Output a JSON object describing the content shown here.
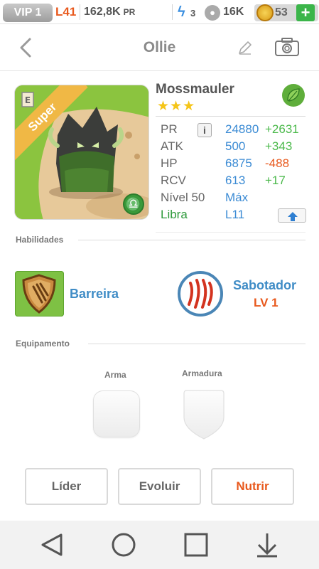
{
  "status": {
    "vip": "VIP 1",
    "level": "L41",
    "power": "162,8K",
    "power_unit": "PR",
    "energy": "3",
    "paws": "16K",
    "coins": "53",
    "add": "+"
  },
  "nav": {
    "title": "Ollie"
  },
  "monster": {
    "name": "Mossmauler",
    "rarity_ribbon": "Super",
    "stars": "★★★",
    "element": "leaf-icon",
    "stats": [
      {
        "label": "PR",
        "value": "24880",
        "bonus": "+2631",
        "bonus_type": "positive"
      },
      {
        "label": "ATK",
        "value": "500",
        "bonus": "+343",
        "bonus_type": "positive"
      },
      {
        "label": "HP",
        "value": "6875",
        "bonus": "-488",
        "bonus_type": "negative"
      },
      {
        "label": "RCV",
        "value": "613",
        "bonus": "+17",
        "bonus_type": "positive"
      }
    ],
    "level_label": "Nível 50",
    "level_value": "Máx",
    "sign_label": "Libra",
    "sign_value": "L11",
    "info": "i"
  },
  "abilities": {
    "section": "Habilidades",
    "skill1": "Barreira",
    "skill2": "Sabotador",
    "skill2_level": "LV 1"
  },
  "equipment": {
    "section": "Equipamento",
    "weapon": "Arma",
    "armor": "Armadura"
  },
  "actions": {
    "leader": "Líder",
    "evolve": "Evoluir",
    "feed": "Nutrir"
  },
  "colors": {
    "accent_orange": "#e8591d",
    "blue": "#3b8bd4",
    "green": "#4bb94b"
  }
}
